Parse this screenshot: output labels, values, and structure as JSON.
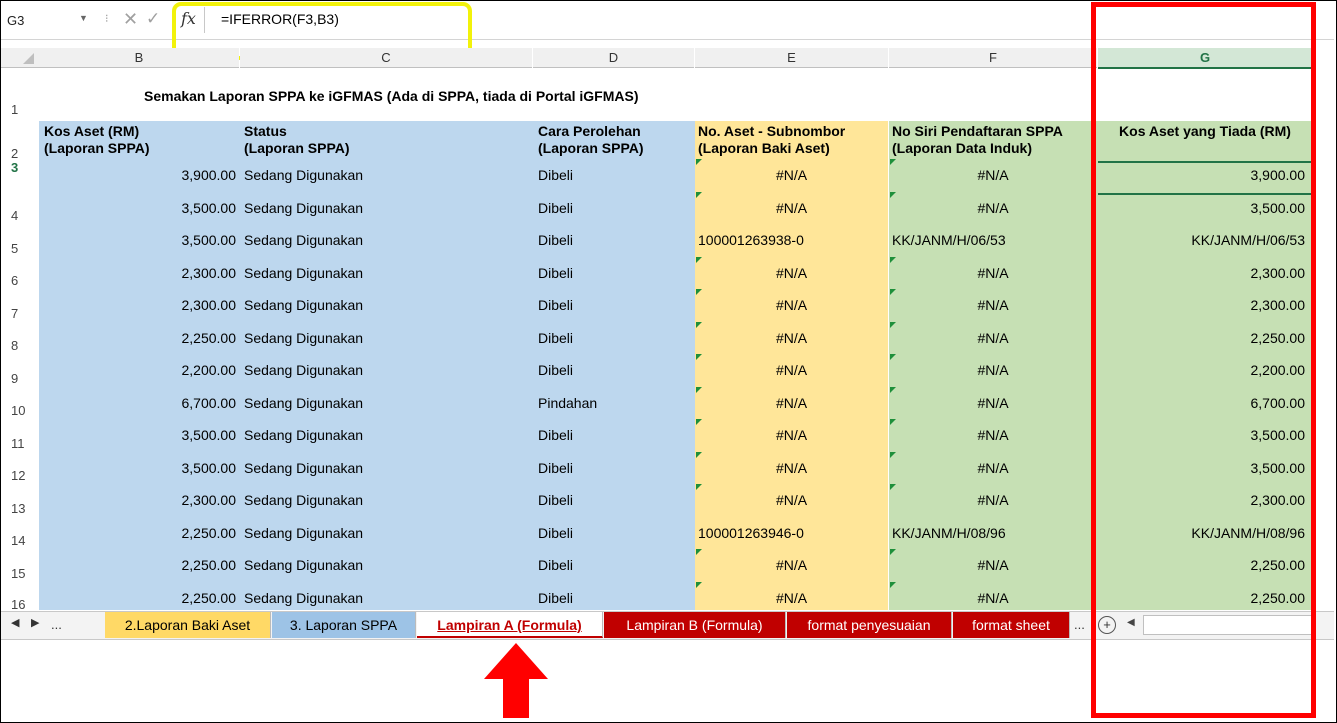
{
  "formula_bar": {
    "name_box": "G3",
    "formula": "=IFERROR(F3,B3)",
    "fx_label": "fx"
  },
  "columns": [
    {
      "letter": "B"
    },
    {
      "letter": "C"
    },
    {
      "letter": "D"
    },
    {
      "letter": "E"
    },
    {
      "letter": "F"
    },
    {
      "letter": "G"
    }
  ],
  "row_numbers": [
    "1",
    "2",
    "3",
    "4",
    "5",
    "6",
    "7",
    "8",
    "9",
    "10",
    "11",
    "12",
    "13",
    "14",
    "15",
    "16"
  ],
  "title": "Semakan Laporan SPPA ke iGFMAS (Ada di SPPA, tiada di Portal iGFMAS)",
  "headers": {
    "b": [
      "Kos Aset (RM)",
      "(Laporan SPPA)"
    ],
    "c": [
      "Status",
      "(Laporan SPPA)"
    ],
    "d": [
      "Cara Perolehan",
      "(Laporan SPPA)"
    ],
    "e": [
      "No. Aset - Subnombor",
      "(Laporan Baki Aset)"
    ],
    "f": [
      "No Siri Pendaftaran SPPA",
      "(Laporan Data Induk)"
    ],
    "g": "Kos Aset yang Tiada (RM)"
  },
  "rows": [
    {
      "b": "3,900.00",
      "c": "Sedang Digunakan",
      "d": "Dibeli",
      "e": "#N/A",
      "f": "#N/A",
      "g": "3,900.00"
    },
    {
      "b": "3,500.00",
      "c": "Sedang Digunakan",
      "d": "Dibeli",
      "e": "#N/A",
      "f": "#N/A",
      "g": "3,500.00"
    },
    {
      "b": "3,500.00",
      "c": "Sedang Digunakan",
      "d": "Dibeli",
      "e": "100001263938-0",
      "f": "KK/JANM/H/06/53",
      "g": "KK/JANM/H/06/53"
    },
    {
      "b": "2,300.00",
      "c": "Sedang Digunakan",
      "d": "Dibeli",
      "e": "#N/A",
      "f": "#N/A",
      "g": "2,300.00"
    },
    {
      "b": "2,300.00",
      "c": "Sedang Digunakan",
      "d": "Dibeli",
      "e": "#N/A",
      "f": "#N/A",
      "g": "2,300.00"
    },
    {
      "b": "2,250.00",
      "c": "Sedang Digunakan",
      "d": "Dibeli",
      "e": "#N/A",
      "f": "#N/A",
      "g": "2,250.00"
    },
    {
      "b": "2,200.00",
      "c": "Sedang Digunakan",
      "d": "Dibeli",
      "e": "#N/A",
      "f": "#N/A",
      "g": "2,200.00"
    },
    {
      "b": "6,700.00",
      "c": "Sedang Digunakan",
      "d": "Pindahan",
      "e": "#N/A",
      "f": "#N/A",
      "g": "6,700.00"
    },
    {
      "b": "3,500.00",
      "c": "Sedang Digunakan",
      "d": "Dibeli",
      "e": "#N/A",
      "f": "#N/A",
      "g": "3,500.00"
    },
    {
      "b": "3,500.00",
      "c": "Sedang Digunakan",
      "d": "Dibeli",
      "e": "#N/A",
      "f": "#N/A",
      "g": "3,500.00"
    },
    {
      "b": "2,300.00",
      "c": "Sedang Digunakan",
      "d": "Dibeli",
      "e": "#N/A",
      "f": "#N/A",
      "g": "2,300.00"
    },
    {
      "b": "2,250.00",
      "c": "Sedang Digunakan",
      "d": "Dibeli",
      "e": "100001263946-0",
      "f": "KK/JANM/H/08/96",
      "g": "KK/JANM/H/08/96"
    },
    {
      "b": "2,250.00",
      "c": "Sedang Digunakan",
      "d": "Dibeli",
      "e": "#N/A",
      "f": "#N/A",
      "g": "2,250.00"
    },
    {
      "b": "2,250.00",
      "c": "Sedang Digunakan",
      "d": "Dibeli",
      "e": "#N/A",
      "f": "#N/A",
      "g": "2,250.00"
    }
  ],
  "sheet_tabs": [
    {
      "label": "2.Laporan Baki Aset",
      "bg": "#ffd966",
      "fg": "#000000"
    },
    {
      "label": "3. Laporan SPPA",
      "bg": "#9dc3e6",
      "fg": "#000000"
    },
    {
      "label": "Lampiran A (Formula)",
      "bg": "#ffffff",
      "fg": "#c00000",
      "active": true
    },
    {
      "label": "Lampiran B (Formula)",
      "bg": "#c00000",
      "fg": "#ffffff"
    },
    {
      "label": "format penyesuaian",
      "bg": "#c00000",
      "fg": "#ffffff"
    },
    {
      "label": "format sheet",
      "bg": "#c00000",
      "fg": "#ffffff"
    }
  ],
  "tab_nav": {
    "ellipsis_left": "...",
    "ellipsis_right": "...",
    "add": "+"
  },
  "colors": {
    "highlight_circle": "#f2f20a",
    "annotation_box": "#ff0000",
    "arrow": "#ff0000",
    "blue_fill": "#bdd7ee",
    "yellow_fill": "#ffe699",
    "green_fill": "#c6e0b4"
  }
}
